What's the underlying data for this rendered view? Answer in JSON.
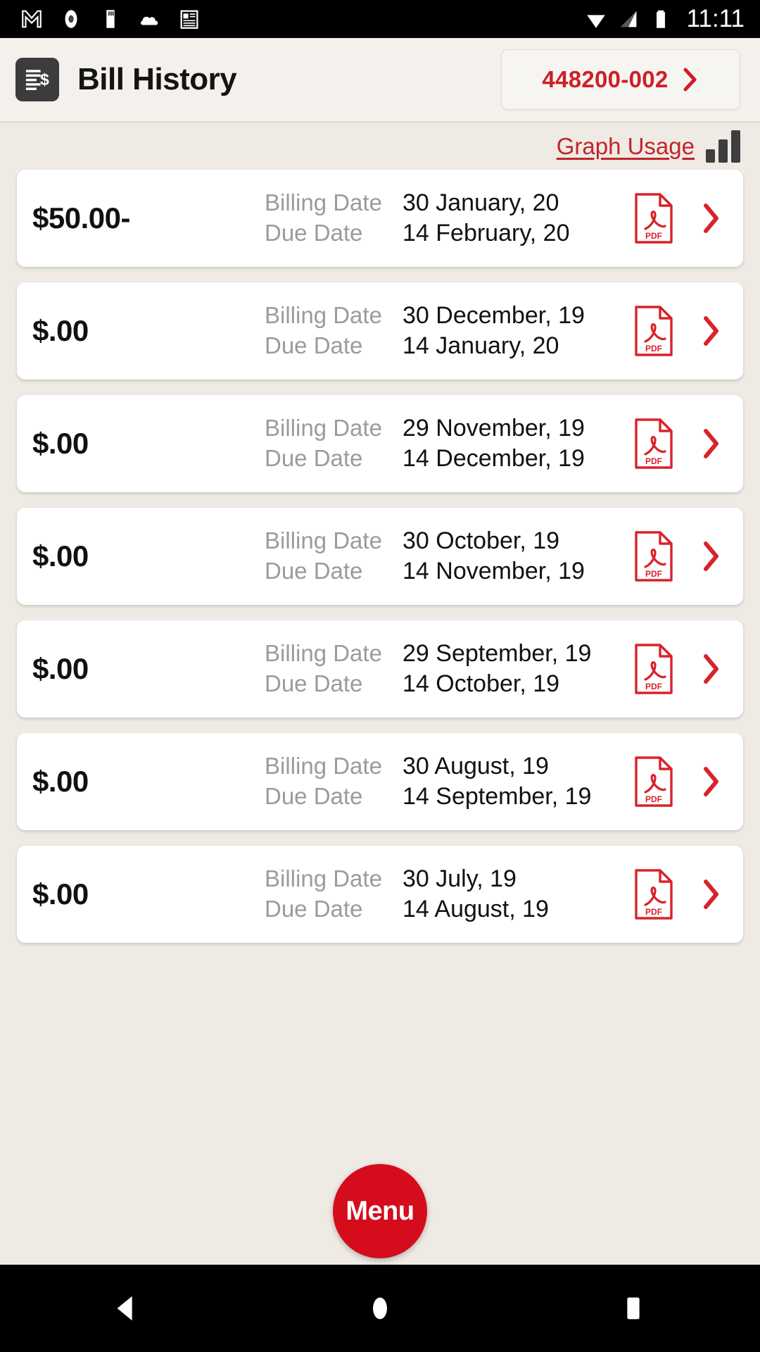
{
  "statusbar": {
    "icons": [
      "gmail-icon",
      "record-icon",
      "sd-card-icon",
      "cloud-icon",
      "news-icon"
    ],
    "wifi_icon": "wifi-icon",
    "signal_icon": "cellular-signal-icon",
    "battery_icon": "battery-full-icon",
    "time": "11:11"
  },
  "appbar": {
    "app_icon": "bill-dollar-icon",
    "title": "Bill History",
    "account_number": "448200-002",
    "account_chevron_icon": "chevron-right-icon"
  },
  "toolbar": {
    "graph_usage_label": "Graph Usage",
    "graph_usage_icon": "bar-chart-icon"
  },
  "bills": [
    {
      "amount": "$50.00-",
      "billing_label": "Billing Date",
      "billing_date": "30 January, 20",
      "due_label": "Due Date",
      "due_date": "14 February, 20",
      "pdf_icon": "pdf-file-icon",
      "chevron_icon": "chevron-right-icon"
    },
    {
      "amount": "$.00",
      "billing_label": "Billing Date",
      "billing_date": "30 December, 19",
      "due_label": "Due Date",
      "due_date": "14 January, 20",
      "pdf_icon": "pdf-file-icon",
      "chevron_icon": "chevron-right-icon"
    },
    {
      "amount": "$.00",
      "billing_label": "Billing Date",
      "billing_date": "29 November, 19",
      "due_label": "Due Date",
      "due_date": "14 December, 19",
      "pdf_icon": "pdf-file-icon",
      "chevron_icon": "chevron-right-icon"
    },
    {
      "amount": "$.00",
      "billing_label": "Billing Date",
      "billing_date": "30 October, 19",
      "due_label": "Due Date",
      "due_date": "14 November, 19",
      "pdf_icon": "pdf-file-icon",
      "chevron_icon": "chevron-right-icon"
    },
    {
      "amount": "$.00",
      "billing_label": "Billing Date",
      "billing_date": "29 September, 19",
      "due_label": "Due Date",
      "due_date": "14 October, 19",
      "pdf_icon": "pdf-file-icon",
      "chevron_icon": "chevron-right-icon"
    },
    {
      "amount": "$.00",
      "billing_label": "Billing Date",
      "billing_date": "30 August, 19",
      "due_label": "Due Date",
      "due_date": "14 September, 19",
      "pdf_icon": "pdf-file-icon",
      "chevron_icon": "chevron-right-icon"
    },
    {
      "amount": "$.00",
      "billing_label": "Billing Date",
      "billing_date": "30 July, 19",
      "due_label": "Due Date",
      "due_date": "14 August, 19",
      "pdf_icon": "pdf-file-icon",
      "chevron_icon": "chevron-right-icon"
    }
  ],
  "fab": {
    "label": "Menu"
  },
  "navbar": {
    "back_icon": "back-triangle-icon",
    "home_icon": "home-circle-icon",
    "recents_icon": "recents-square-icon"
  },
  "colors": {
    "accent_red": "#cc2026",
    "fab_red": "#d50c1c",
    "page_bg": "#efeae4",
    "appbar_bg": "#f4f1ec",
    "card_bg": "#ffffff",
    "label_gray": "#9b9b9b"
  }
}
